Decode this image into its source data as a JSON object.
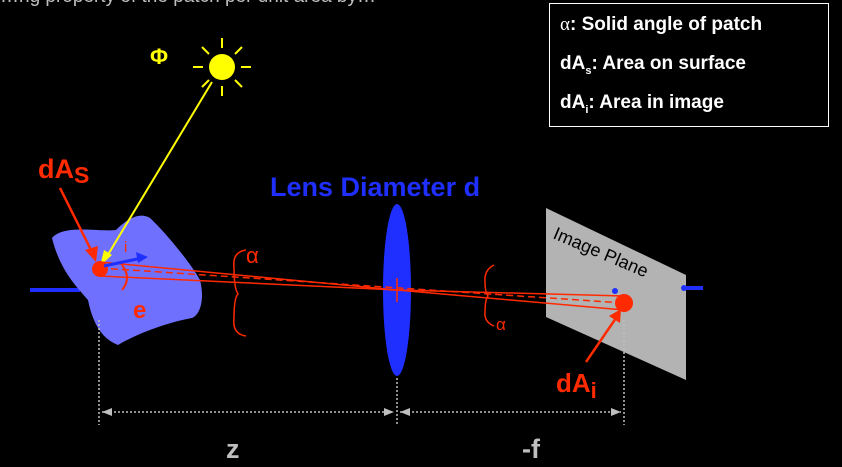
{
  "top_caption": "…ng property of the patch per unit area by…",
  "legend": {
    "items": [
      {
        "symbol": "α",
        "text": ": Solid angle of patch"
      },
      {
        "symbol": "dA",
        "sub": "s",
        "text": ": Area on surface"
      },
      {
        "symbol": "dA",
        "sub": "i",
        "text": ": Area in image"
      }
    ]
  },
  "labels": {
    "phi": "Φ",
    "dAs_main": "dA",
    "dAs_sub": "S",
    "lens": "Lens Diameter d",
    "image_plane": "Image Plane",
    "dAi_main": "dA",
    "dAi_sub": "i",
    "alpha_left": "α",
    "alpha_right": "α",
    "i": "i",
    "e": "e",
    "z": "z",
    "f": "-f"
  },
  "colors": {
    "background": "#000000",
    "red": "#ff2a00",
    "blue": "#1f2fff",
    "yellow": "#ffff00",
    "surface": "#7070ff",
    "plane": "#b3b3b3",
    "dim": "#bfbfbf"
  }
}
